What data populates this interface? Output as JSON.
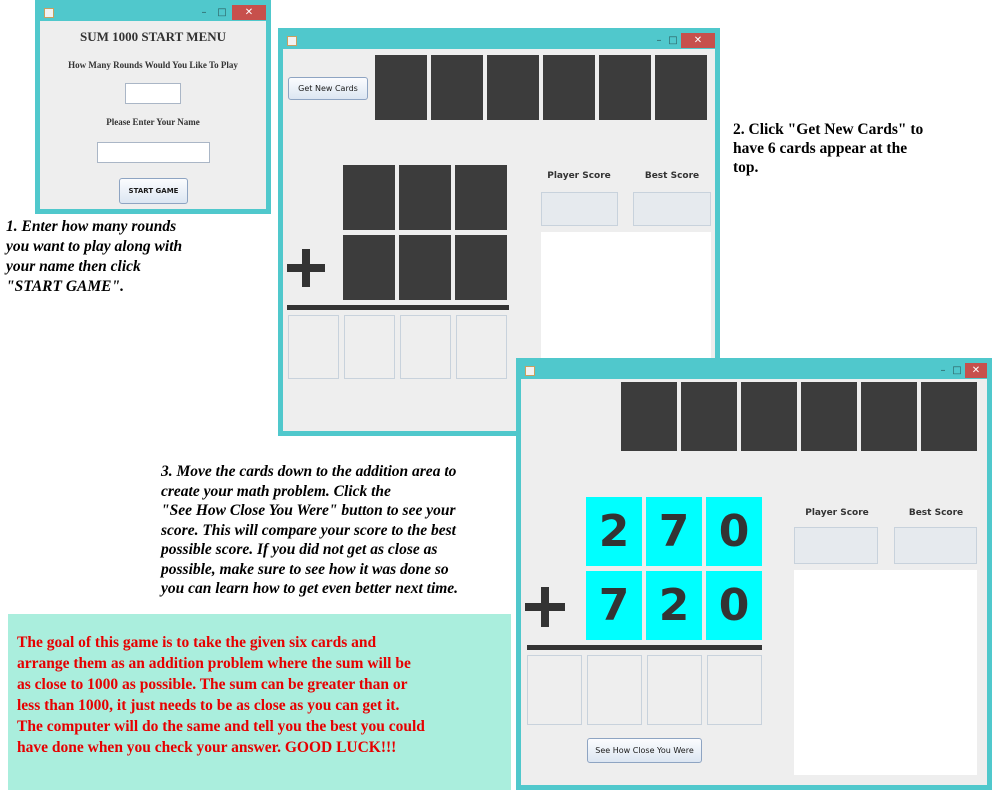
{
  "window1": {
    "title": "SUM 1000 START MENU",
    "rounds_prompt": "How Many Rounds Would You Like To Play",
    "rounds_value": "",
    "name_prompt": "Please Enter Your Name",
    "name_value": "",
    "start_button": "START GAME",
    "controls": {
      "minimize": "–",
      "maximize": "□",
      "close": "✕"
    }
  },
  "window2": {
    "get_cards_button": "Get New Cards",
    "player_score_label": "Player Score",
    "best_score_label": "Best Score",
    "controls": {
      "minimize": "–",
      "maximize": "□",
      "close": "✕"
    }
  },
  "window3": {
    "player_score_label": "Player Score",
    "best_score_label": "Best Score",
    "top_number": [
      "2",
      "7",
      "0"
    ],
    "bottom_number": [
      "7",
      "2",
      "0"
    ],
    "see_how_close_button": "See How Close You Were",
    "controls": {
      "minimize": "–",
      "maximize": "□",
      "close": "✕"
    }
  },
  "captions": {
    "step1": [
      "1. Enter how many rounds",
      "you want to play along with",
      "your name then click",
      "\"START GAME\"."
    ],
    "step2": [
      "2. Click \"Get New Cards\" to",
      "have 6 cards appear at the",
      "top."
    ],
    "step3": [
      "3. Move the cards down to the addition area to",
      "create your math problem. Click the",
      "\"See How Close You Were\" button to see your",
      "score. This will compare your score to the best",
      "possible score. If you did not get as close as",
      "possible, make sure to see how it was done so",
      "you can learn how to get even better next time."
    ]
  },
  "goal_text": [
    "The goal of this game is to take the given six cards and",
    "arrange them as an addition problem where the sum will be",
    "as close to 1000 as possible. The sum can be greater than or",
    "less than 1000, it just needs to be as close as you can get it.",
    "The computer will do the same and tell you the best you could",
    "have done when you check your answer. GOOD LUCK!!!"
  ],
  "colors": {
    "window_border": "#50c8cc",
    "card": "#3c3c3c",
    "selected_card": "#00ffff",
    "goal_bg": "#aaeedd",
    "goal_text": "#e60000",
    "close_button": "#c7504c"
  }
}
